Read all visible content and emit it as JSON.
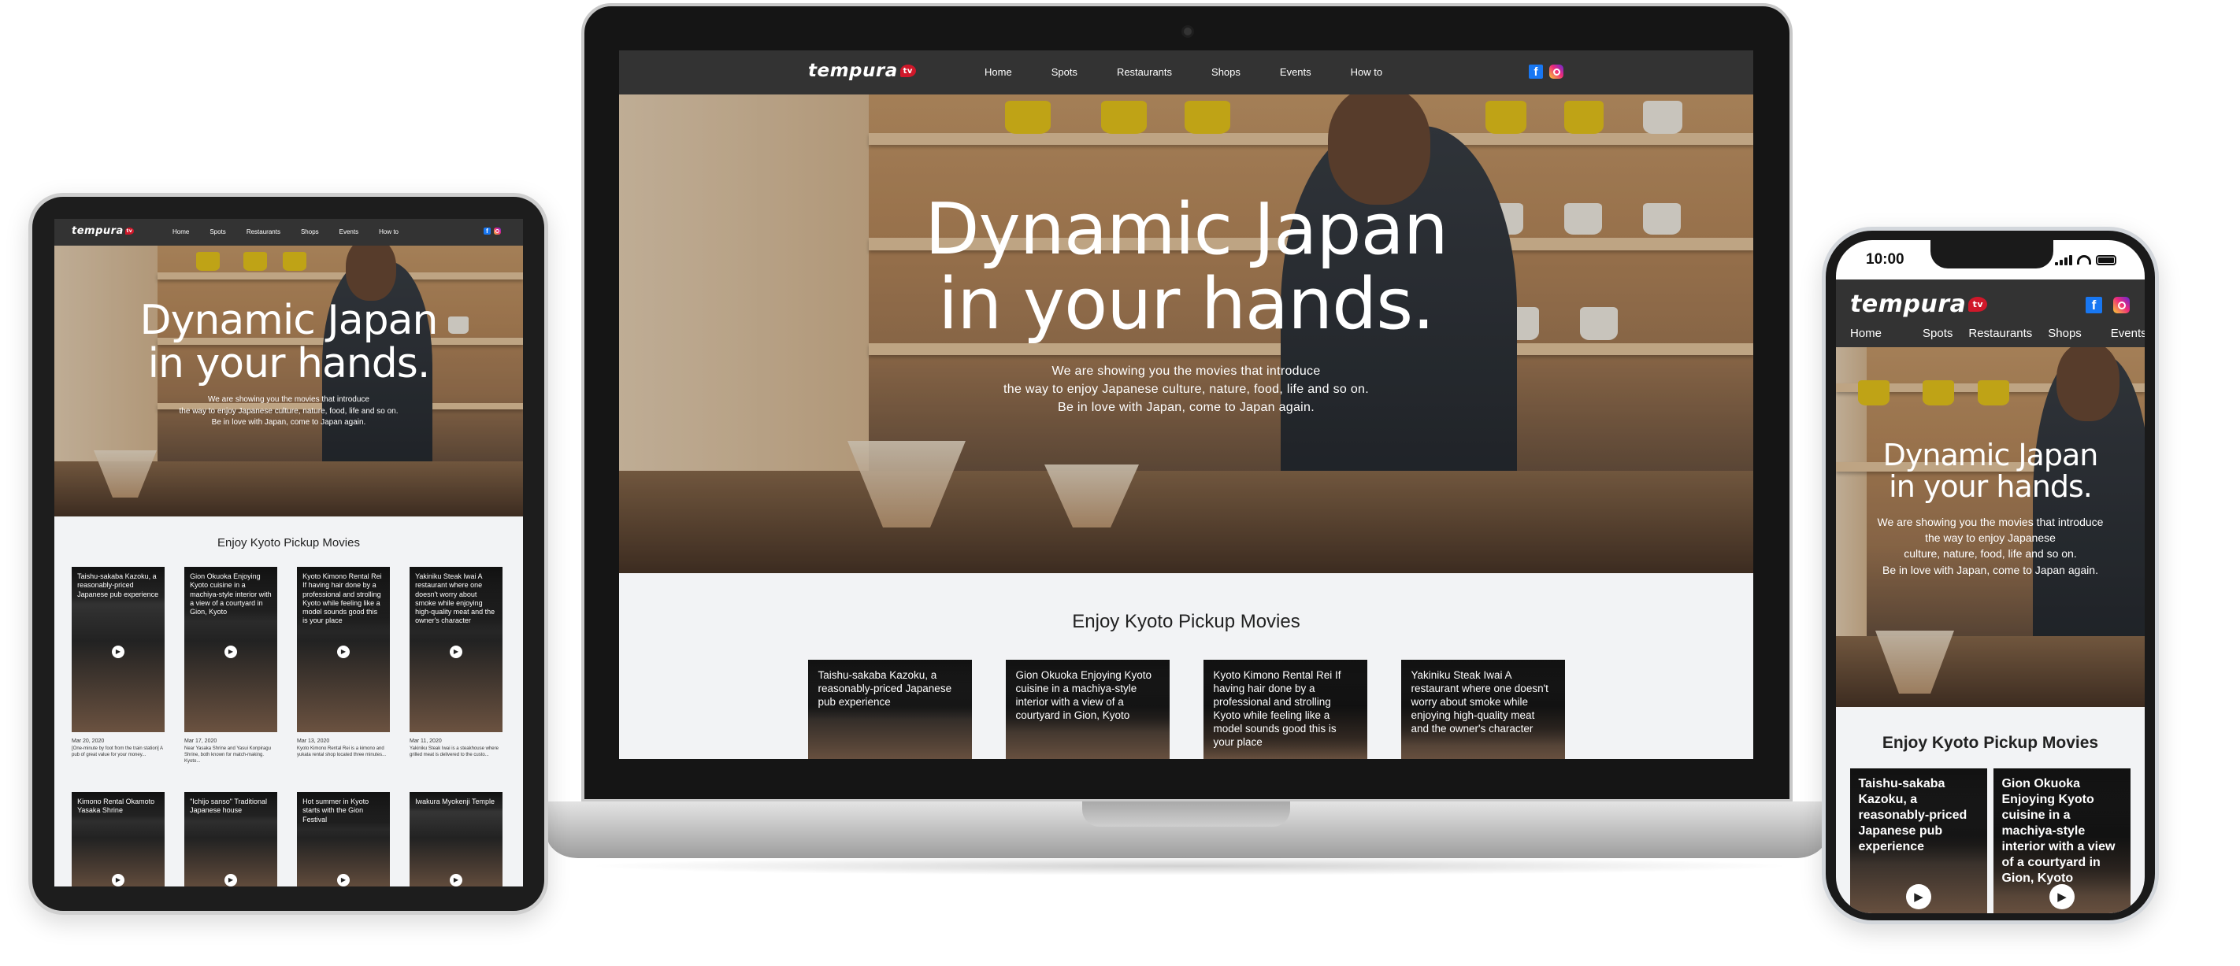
{
  "brand": {
    "name": "tempura",
    "badge": "tv",
    "accent": "#d0182a"
  },
  "nav": {
    "items": [
      "Home",
      "Spots",
      "Restaurants",
      "Shops",
      "Events",
      "How to"
    ]
  },
  "social": {
    "facebook": "f",
    "facebook_icon": "facebook-icon",
    "instagram_icon": "instagram-icon"
  },
  "hero": {
    "title_line1": "Dynamic Japan",
    "title_line2": "in your hands.",
    "desc_line1": "We are showing you the movies that introduce",
    "desc_line2": "the way to enjoy Japanese culture, nature, food, life and so on.",
    "desc_line3": "Be in love with Japan, come to Japan again."
  },
  "phone_hero": {
    "desc_line1": "We are showing you the movies that introduce",
    "desc_line2": "the way to enjoy Japanese",
    "desc_line3": "culture, nature, food, life and so on.",
    "desc_line4": "Be in love with Japan, come to Japan again."
  },
  "section": {
    "title": "Enjoy Kyoto Pickup Movies"
  },
  "cards": [
    "Taishu-sakaba Kazoku, a reasonably-priced Japanese pub experience",
    "Gion Okuoka Enjoying Kyoto cuisine in a machiya-style interior with a view of a courtyard in Gion, Kyoto",
    "Kyoto Kimono Rental Rei If having hair done by a professional and strolling Kyoto while feeling like a model sounds good this is your place",
    "Yakiniku Steak Iwai A restaurant where one doesn't worry about smoke while enjoying high-quality meat and the owner's character"
  ],
  "tablet_cards_row1": [
    {
      "title": "Taishu-sakaba Kazoku, a reasonably-priced Japanese pub experience",
      "date": "Mar 20, 2020",
      "desc": "[One-minute by foot from the train station] A pub of great value for your money..."
    },
    {
      "title": "Gion Okuoka Enjoying Kyoto cuisine in a machiya-style interior with a view of a courtyard in Gion, Kyoto",
      "date": "Mar 17, 2020",
      "desc": "Near Yasaka Shrine and Yasui Konpiragu Shrine, both known for match-making. Kyoto..."
    },
    {
      "title": "Kyoto Kimono Rental Rei If having hair done by a professional and strolling Kyoto while feeling like a model sounds good this is your place",
      "date": "Mar 13, 2020",
      "desc": "Kyoto Kimono Rental Rei is a kimono and yukata rental shop located three minutes..."
    },
    {
      "title": "Yakiniku Steak Iwai A restaurant where one doesn't worry about smoke while enjoying high-quality meat and the owner's character",
      "date": "Mar 11, 2020",
      "desc": "Yakiniku Steak Iwai is a steakhouse where grilled meat is delivered to the custo..."
    }
  ],
  "tablet_cards_row2": [
    "Kimono Rental Okamoto Yasaka Shrine",
    "\"Ichijo sanso\" Traditional Japanese house",
    "Hot summer in Kyoto starts with the Gion Festival",
    "Iwakura Myokenji Temple"
  ],
  "phone_status": {
    "time": "10:00"
  },
  "colors": {
    "nav_bg": "#333333",
    "section_bg": "#f2f3f5",
    "facebook": "#1877f2"
  }
}
